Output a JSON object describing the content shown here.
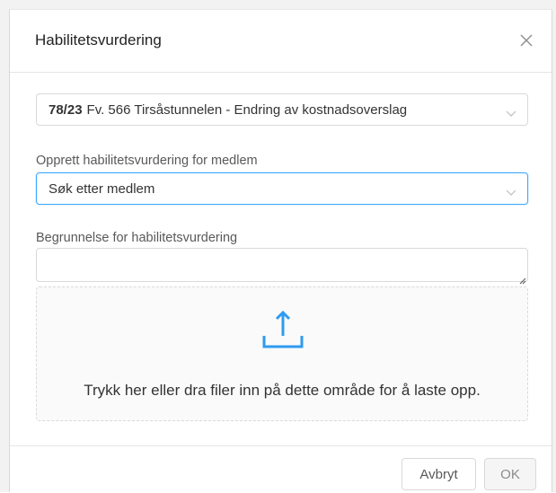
{
  "dialog": {
    "title": "Habilitetsvurdering",
    "close_icon": "close-icon"
  },
  "case_select": {
    "case_number": "78/23",
    "case_title": "Fv. 566 Tirsåstunnelen - Endring av kostnadsoverslag",
    "icon": "chevron-down-icon"
  },
  "member_field": {
    "label": "Opprett habilitetsvurdering for medlem",
    "placeholder": "Søk etter medlem",
    "icon": "chevron-down-icon"
  },
  "reason_field": {
    "label": "Begrunnelse for habilitetsvurdering",
    "value": ""
  },
  "upload": {
    "icon": "upload-icon",
    "text": "Trykk her eller dra filer inn på dette område for å laste opp."
  },
  "footer": {
    "cancel_label": "Avbryt",
    "ok_label": "OK"
  },
  "colors": {
    "accent": "#40a9ff",
    "upload_icon": "#2f9bf0",
    "border": "#d9d9d9"
  }
}
